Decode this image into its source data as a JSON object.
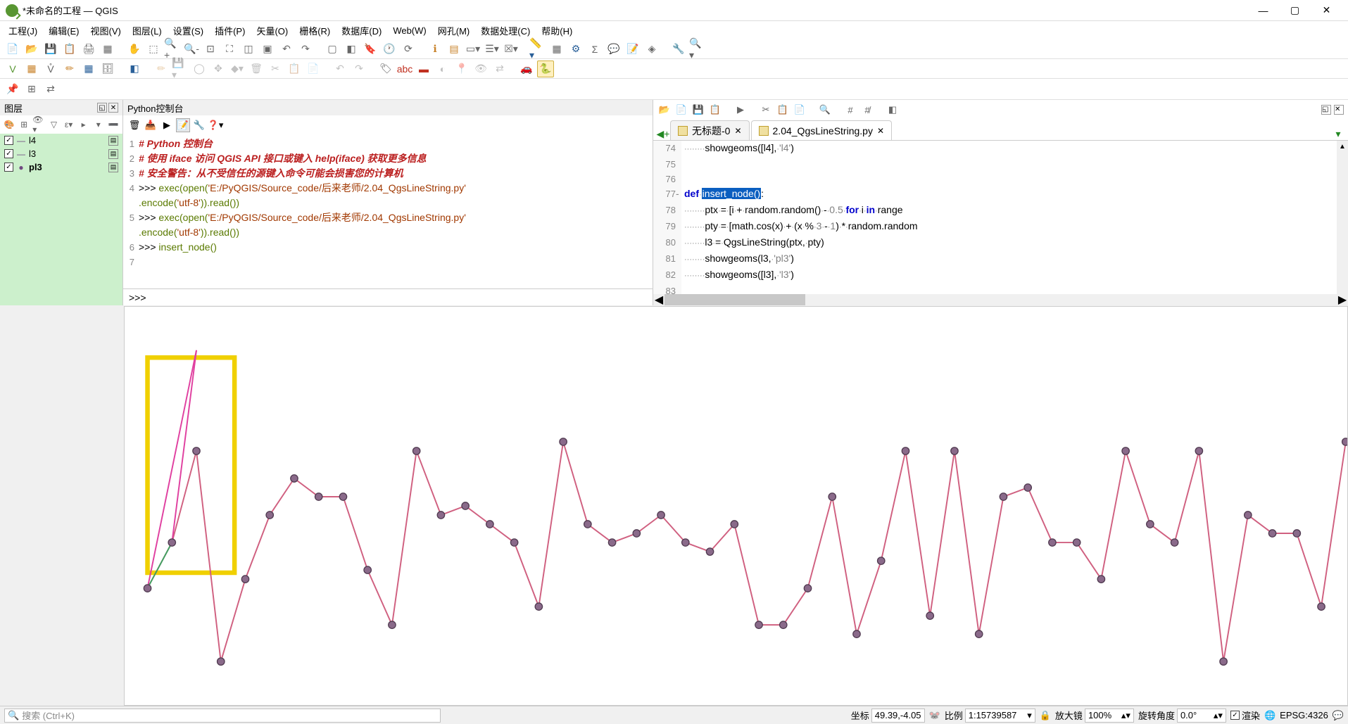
{
  "title": "*未命名的工程 — QGIS",
  "menus": [
    "工程(J)",
    "编辑(E)",
    "视图(V)",
    "图层(L)",
    "设置(S)",
    "插件(P)",
    "矢量(O)",
    "栅格(R)",
    "数据库(D)",
    "Web(W)",
    "网孔(M)",
    "数据处理(C)",
    "帮助(H)"
  ],
  "layers_panel": {
    "title": "图层",
    "items": [
      {
        "checked": true,
        "symbol": "—",
        "name": "l4"
      },
      {
        "checked": true,
        "symbol": "—",
        "name": "l3"
      },
      {
        "checked": true,
        "symbol": "●",
        "name": "pl3",
        "bold": true
      }
    ]
  },
  "pyconsole": {
    "title": "Python控制台",
    "lines": [
      {
        "n": 1,
        "cls": "c-red",
        "t": "# Python 控制台"
      },
      {
        "n": 2,
        "cls": "c-red",
        "t": "# 使用 iface 访问 QGIS API 接口或键入 help(iface) 获取更多信息"
      },
      {
        "n": 3,
        "cls": "c-red",
        "t": "# 安全警告：从不受信任的源键入命令可能会损害您的计算机"
      }
    ],
    "exec_lines": [
      {
        "n": 4,
        "pre": ">>> ",
        "call": "exec",
        "open": "(open(",
        "str": "'E:/PyQGIS/Source_code/后来老师/2.04_QgsLineString.py'"
      },
      {
        "cont": true,
        "enc": ".encode(",
        "encstr": "'utf-8'",
        "tail": ")).read())"
      },
      {
        "n": 5,
        "pre": ">>> ",
        "call": "exec",
        "open": "(open(",
        "str": "'E:/PyQGIS/Source_code/后来老师/2.04_QgsLineString.py'"
      },
      {
        "cont": true,
        "enc": ".encode(",
        "encstr": "'utf-8'",
        "tail": ")).read())"
      },
      {
        "n": 6,
        "pre": ">>> ",
        "plain": "insert_node()"
      },
      {
        "n": 7,
        "pre": "",
        "plain": ""
      }
    ],
    "prompt": ">>>"
  },
  "editor": {
    "tabs": [
      {
        "name": "无标题-0",
        "active": false
      },
      {
        "name": "2.04_QgsLineString.py",
        "active": true
      }
    ],
    "lines": [
      {
        "n": 74,
        "indent": "        ",
        "body": [
          {
            "t": "showgeoms([l4], "
          },
          {
            "t": "'l4'",
            "c": "estr"
          },
          {
            "t": ")"
          }
        ]
      },
      {
        "n": 75,
        "indent": "",
        "body": []
      },
      {
        "n": 76,
        "indent": "",
        "body": []
      },
      {
        "n": 77,
        "fold": "-",
        "indent": "",
        "body": [
          {
            "t": "def",
            "c": "kw"
          },
          {
            "t": " "
          },
          {
            "t": "insert_node()",
            "sel": true
          },
          {
            "t": ":"
          }
        ]
      },
      {
        "n": 78,
        "indent": "        ",
        "body": [
          {
            "t": "ptx = [i + random.random() - "
          },
          {
            "t": "0.5",
            "c": "num"
          },
          {
            "t": " "
          },
          {
            "t": "for",
            "c": "kw"
          },
          {
            "t": " i "
          },
          {
            "t": "in",
            "c": "kw"
          },
          {
            "t": " range"
          }
        ]
      },
      {
        "n": 79,
        "indent": "        ",
        "body": [
          {
            "t": "pty = [math.cos(x) + (x % "
          },
          {
            "t": "3",
            "c": "num"
          },
          {
            "t": " - "
          },
          {
            "t": "1",
            "c": "num"
          },
          {
            "t": ") * random.random"
          }
        ]
      },
      {
        "n": 80,
        "indent": "        ",
        "body": [
          {
            "t": "l3 = QgsLineString(ptx, pty)"
          }
        ]
      },
      {
        "n": 81,
        "indent": "        ",
        "body": [
          {
            "t": "showgeoms(l3, "
          },
          {
            "t": "'pl3'",
            "c": "estr"
          },
          {
            "t": ")"
          }
        ]
      },
      {
        "n": 82,
        "indent": "        ",
        "body": [
          {
            "t": "showgeoms([l3], "
          },
          {
            "t": "'l3'",
            "c": "estr"
          },
          {
            "t": ")"
          }
        ]
      },
      {
        "n": 83,
        "indent": "",
        "body": []
      }
    ]
  },
  "chart_data": {
    "type": "line",
    "series": [
      {
        "name": "l3",
        "color": "#d06080",
        "x_range": [
          0,
          49
        ],
        "y": [
          -0.9,
          -0.4,
          0.6,
          -1.7,
          -0.8,
          -0.1,
          0.3,
          0.1,
          0.1,
          -0.7,
          -1.3,
          0.6,
          -0.1,
          0.0,
          -0.2,
          -0.4,
          -1.1,
          0.7,
          -0.2,
          -0.4,
          -0.3,
          -0.1,
          -0.4,
          -0.5,
          -0.2,
          -1.3,
          -1.3,
          -0.9,
          0.1,
          -1.4,
          -0.6,
          0.6,
          -1.2,
          0.6,
          -1.4,
          0.1,
          0.2,
          -0.4,
          -0.4,
          -0.8,
          0.6,
          -0.2,
          -0.4,
          0.6,
          -1.7,
          -0.1,
          -0.3,
          -0.3,
          -1.1,
          0.7
        ]
      }
    ],
    "highlight_box": {
      "xmin": 0,
      "xmax": 3,
      "color": "#f0d000"
    },
    "extra_segments": [
      {
        "from": [
          0,
          -0.9
        ],
        "to": [
          2,
          1.7
        ],
        "color": "#e040a0"
      },
      {
        "from": [
          1,
          -0.4
        ],
        "to": [
          2,
          1.7
        ],
        "color": "#e040a0"
      }
    ]
  },
  "status": {
    "search_placeholder": "搜索 (Ctrl+K)",
    "coord_label": "坐标",
    "coord_value": "49.39,-4.05",
    "scale_label": "比例",
    "scale_value": "1:15739587",
    "mag_label": "放大镜",
    "mag_value": "100%",
    "rot_label": "旋转角度",
    "rot_value": "0.0°",
    "render_label": "渲染",
    "epsg": "EPSG:4326"
  }
}
